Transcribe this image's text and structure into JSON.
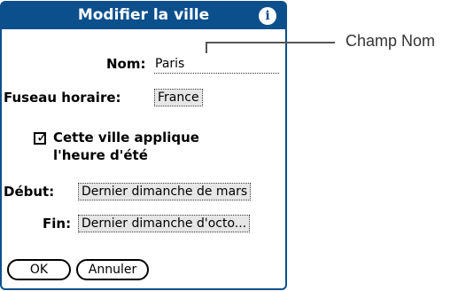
{
  "dialog": {
    "title": "Modifier la ville",
    "info_icon": "i",
    "name_label": "Nom:",
    "name_value": "Paris",
    "timezone_label": "Fuseau horaire:",
    "timezone_value": "France",
    "dst_checkbox_label_line1": "Cette ville applique",
    "dst_checkbox_label_line2": "l'heure d'été",
    "dst_checked": true,
    "start_label": "Début:",
    "start_value": "Dernier dimanche de mars",
    "end_label": "Fin:",
    "end_value": "Dernier dimanche d'octo...",
    "ok_label": "OK",
    "cancel_label": "Annuler"
  },
  "callout": {
    "label": "Champ Nom"
  },
  "colors": {
    "titlebar": "#0b4f8c"
  }
}
